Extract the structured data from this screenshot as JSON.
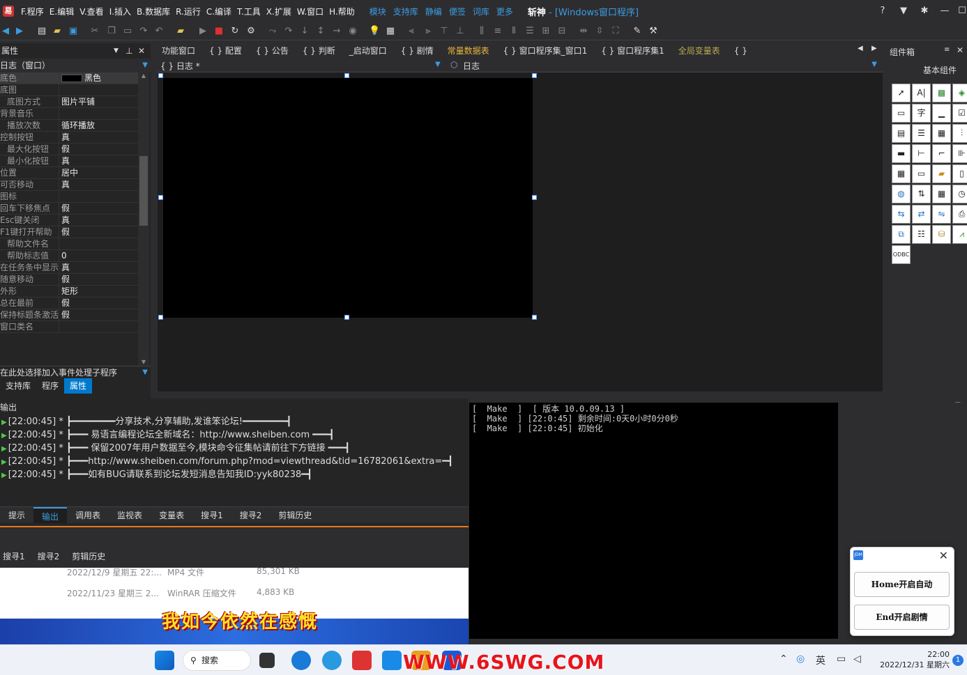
{
  "menu": {
    "items": [
      "F.程序",
      "E.编辑",
      "V.查看",
      "I.插入",
      "B.数据库",
      "R.运行",
      "C.编译",
      "T.工具",
      "X.扩展",
      "W.窗口",
      "H.帮助"
    ],
    "extras": [
      "模块",
      "支持库",
      "静编",
      "便签",
      "词库",
      "更多"
    ],
    "title_brand": "斩神",
    "title_rest": " - [Windows窗口程序]"
  },
  "props": {
    "header": "属性",
    "object": "日志（窗口）",
    "rows": [
      {
        "name": "底色",
        "value": "黑色",
        "sub": false
      },
      {
        "name": "底图",
        "value": "",
        "sub": false
      },
      {
        "name": "底图方式",
        "value": "图片平铺",
        "sub": true
      },
      {
        "name": "背景音乐",
        "value": "",
        "sub": false
      },
      {
        "name": "播放次数",
        "value": "循环播放",
        "sub": true
      },
      {
        "name": "控制按钮",
        "value": "真",
        "sub": false
      },
      {
        "name": "最大化按钮",
        "value": "假",
        "sub": true
      },
      {
        "name": "最小化按钮",
        "value": "真",
        "sub": true
      },
      {
        "name": "位置",
        "value": "居中",
        "sub": false
      },
      {
        "name": "可否移动",
        "value": "真",
        "sub": false
      },
      {
        "name": "图标",
        "value": "",
        "sub": false
      },
      {
        "name": "回车下移焦点",
        "value": "假",
        "sub": false
      },
      {
        "name": "Esc键关闭",
        "value": "真",
        "sub": false
      },
      {
        "name": "F1键打开帮助",
        "value": "假",
        "sub": false
      },
      {
        "name": "帮助文件名",
        "value": "",
        "sub": true
      },
      {
        "name": "帮助标志值",
        "value": "0",
        "sub": true
      },
      {
        "name": "在任务条中显示",
        "value": "真",
        "sub": false
      },
      {
        "name": "随意移动",
        "value": "假",
        "sub": false
      },
      {
        "name": "外形",
        "value": "矩形",
        "sub": false
      },
      {
        "name": "总在最前",
        "value": "假",
        "sub": false
      },
      {
        "name": "保持标题条激活",
        "value": "假",
        "sub": false
      },
      {
        "name": "窗口类名",
        "value": "",
        "sub": false
      }
    ],
    "event_hint": "在此处选择加入事件处理子程序",
    "tabs": [
      "支持库",
      "程序",
      "属性"
    ]
  },
  "editor": {
    "tabs": [
      {
        "label": "功能窗口",
        "style": ""
      },
      {
        "label": "{ } 配置",
        "style": ""
      },
      {
        "label": "{ } 公告",
        "style": ""
      },
      {
        "label": "{ } 判断",
        "style": ""
      },
      {
        "label": "_启动窗口",
        "style": ""
      },
      {
        "label": "{ } 剧情",
        "style": ""
      },
      {
        "label": "常量数据表",
        "style": "yellow"
      },
      {
        "label": "{ } 窗口程序集_窗口1",
        "style": ""
      },
      {
        "label": "{ } 窗口程序集1",
        "style": ""
      },
      {
        "label": "全局变量表",
        "style": "dimyellow"
      },
      {
        "label": "{ }",
        "style": ""
      }
    ],
    "sub_left": "{ } 日志 *",
    "sub_right": "日志"
  },
  "components": {
    "header": "组件箱",
    "group": "基本组件"
  },
  "output": {
    "header": "输出",
    "lines": [
      "[22:00:45] * ┣━━━━━━━━分享技术,分享辅助,发谁笨论坛!━━━━━━━━┫",
      "[22:00:45] * ┣━━━     易语言编程论坛全新域名：http://www.sheiben.com        ━━━┫",
      "[22:00:45] * ┣━━━     保留2007年用户数据至今,模块命令征集帖请前往下方链接     ━━━┫",
      "[22:00:45] * ┣━━━http://www.sheiben.com/forum.php?mod=viewthread&tid=16782061&extra=━┫",
      "[22:00:45] * ┣━━━如有BUG请联系到论坛发短消息告知我ID:yyk80238━┫"
    ],
    "tabs": [
      "提示",
      "输出",
      "调用表",
      "监视表",
      "变量表",
      "搜寻1",
      "搜寻2",
      "剪辑历史"
    ],
    "dup_tabs": [
      "搜寻1",
      "搜寻2",
      "剪辑历史"
    ]
  },
  "explorer": {
    "rows": [
      {
        "date": "2022/12/9 星期五 22:...",
        "type": "MP4 文件",
        "size": "85,301 KB"
      },
      {
        "date": "2022/11/23 星期三 2...",
        "type": "WinRAR 压缩文件",
        "size": "4,883 KB"
      }
    ]
  },
  "subtitle": "我如今依然在感慨",
  "console": {
    "lines": [
      "[  Make  ]  [ 版本 10.0.09.13 ]",
      "[  Make  ] [22:0:45] 剩余时间:0天0小时0分0秒",
      "[  Make  ] [22:0:45] 初始化"
    ]
  },
  "dialog": {
    "icon": "JDM",
    "buttons": [
      "Home开启自动",
      "End开启剧情"
    ]
  },
  "taskbar": {
    "search": "搜索",
    "watermark": "WWW.6SWG.COM",
    "ime": "英",
    "time": "22:00",
    "date": "2022/12/31 星期六",
    "notification_count": "1"
  },
  "colors": {
    "accent": "#3c9de0",
    "selection": "#007acc",
    "orange": "#e87a1a"
  }
}
